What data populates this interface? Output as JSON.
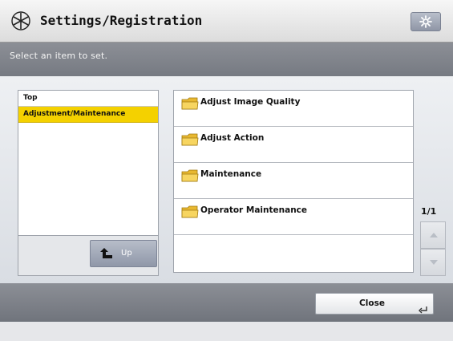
{
  "header": {
    "title": "Settings/Registration",
    "title_icon": "settings-star-icon",
    "right_button_icon": "gear-icon"
  },
  "message": {
    "text": "Select an item to set."
  },
  "tree": {
    "items": [
      {
        "label": "Top",
        "selected": false
      },
      {
        "label": "Adjustment/Maintenance",
        "selected": true
      }
    ],
    "up_button": {
      "label": "Up",
      "icon": "up-arrow-icon"
    }
  },
  "items": [
    {
      "label": "Adjust Image Quality",
      "icon": "folder-icon"
    },
    {
      "label": "Adjust Action",
      "icon": "folder-icon"
    },
    {
      "label": "Maintenance",
      "icon": "folder-icon"
    },
    {
      "label": "Operator Maintenance",
      "icon": "folder-icon"
    }
  ],
  "pagination": {
    "page": "1/1",
    "scroll_up_icon": "triangle-up-icon",
    "scroll_down_icon": "triangle-down-icon"
  },
  "footer": {
    "close_label": "Close",
    "close_icon": "enter-icon"
  },
  "colors": {
    "selection": "#f4d100",
    "bar": "#7e8189",
    "button": "#9aa1b2"
  }
}
